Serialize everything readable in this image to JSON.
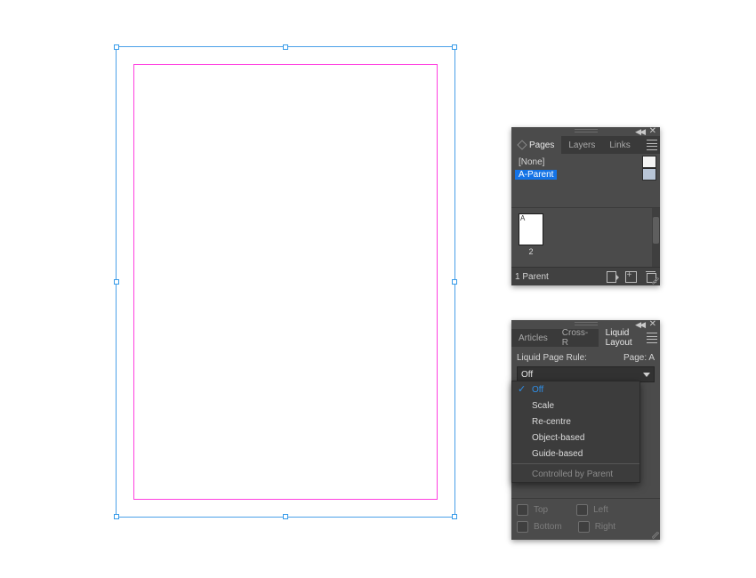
{
  "canvas": {
    "page_label": "A",
    "page_number": "2"
  },
  "pages_panel": {
    "tabs": {
      "pages": "Pages",
      "layers": "Layers",
      "links": "Links"
    },
    "masters": {
      "none": "[None]",
      "a_parent": "A-Parent"
    },
    "footer": {
      "status": "1 Parent"
    }
  },
  "liquid_panel": {
    "tabs": {
      "articles": "Articles",
      "crossr": "Cross-R",
      "liquid": "Liquid Layout"
    },
    "rule_label": "Liquid Page Rule:",
    "page_label": "Page: A",
    "select_value": "Off",
    "options": {
      "off": "Off",
      "scale": "Scale",
      "recentre": "Re-centre",
      "object": "Object-based",
      "guide": "Guide-based",
      "controlled": "Controlled by Parent"
    },
    "pins": {
      "top": "Top",
      "left": "Left",
      "bottom": "Bottom",
      "right": "Right"
    }
  }
}
